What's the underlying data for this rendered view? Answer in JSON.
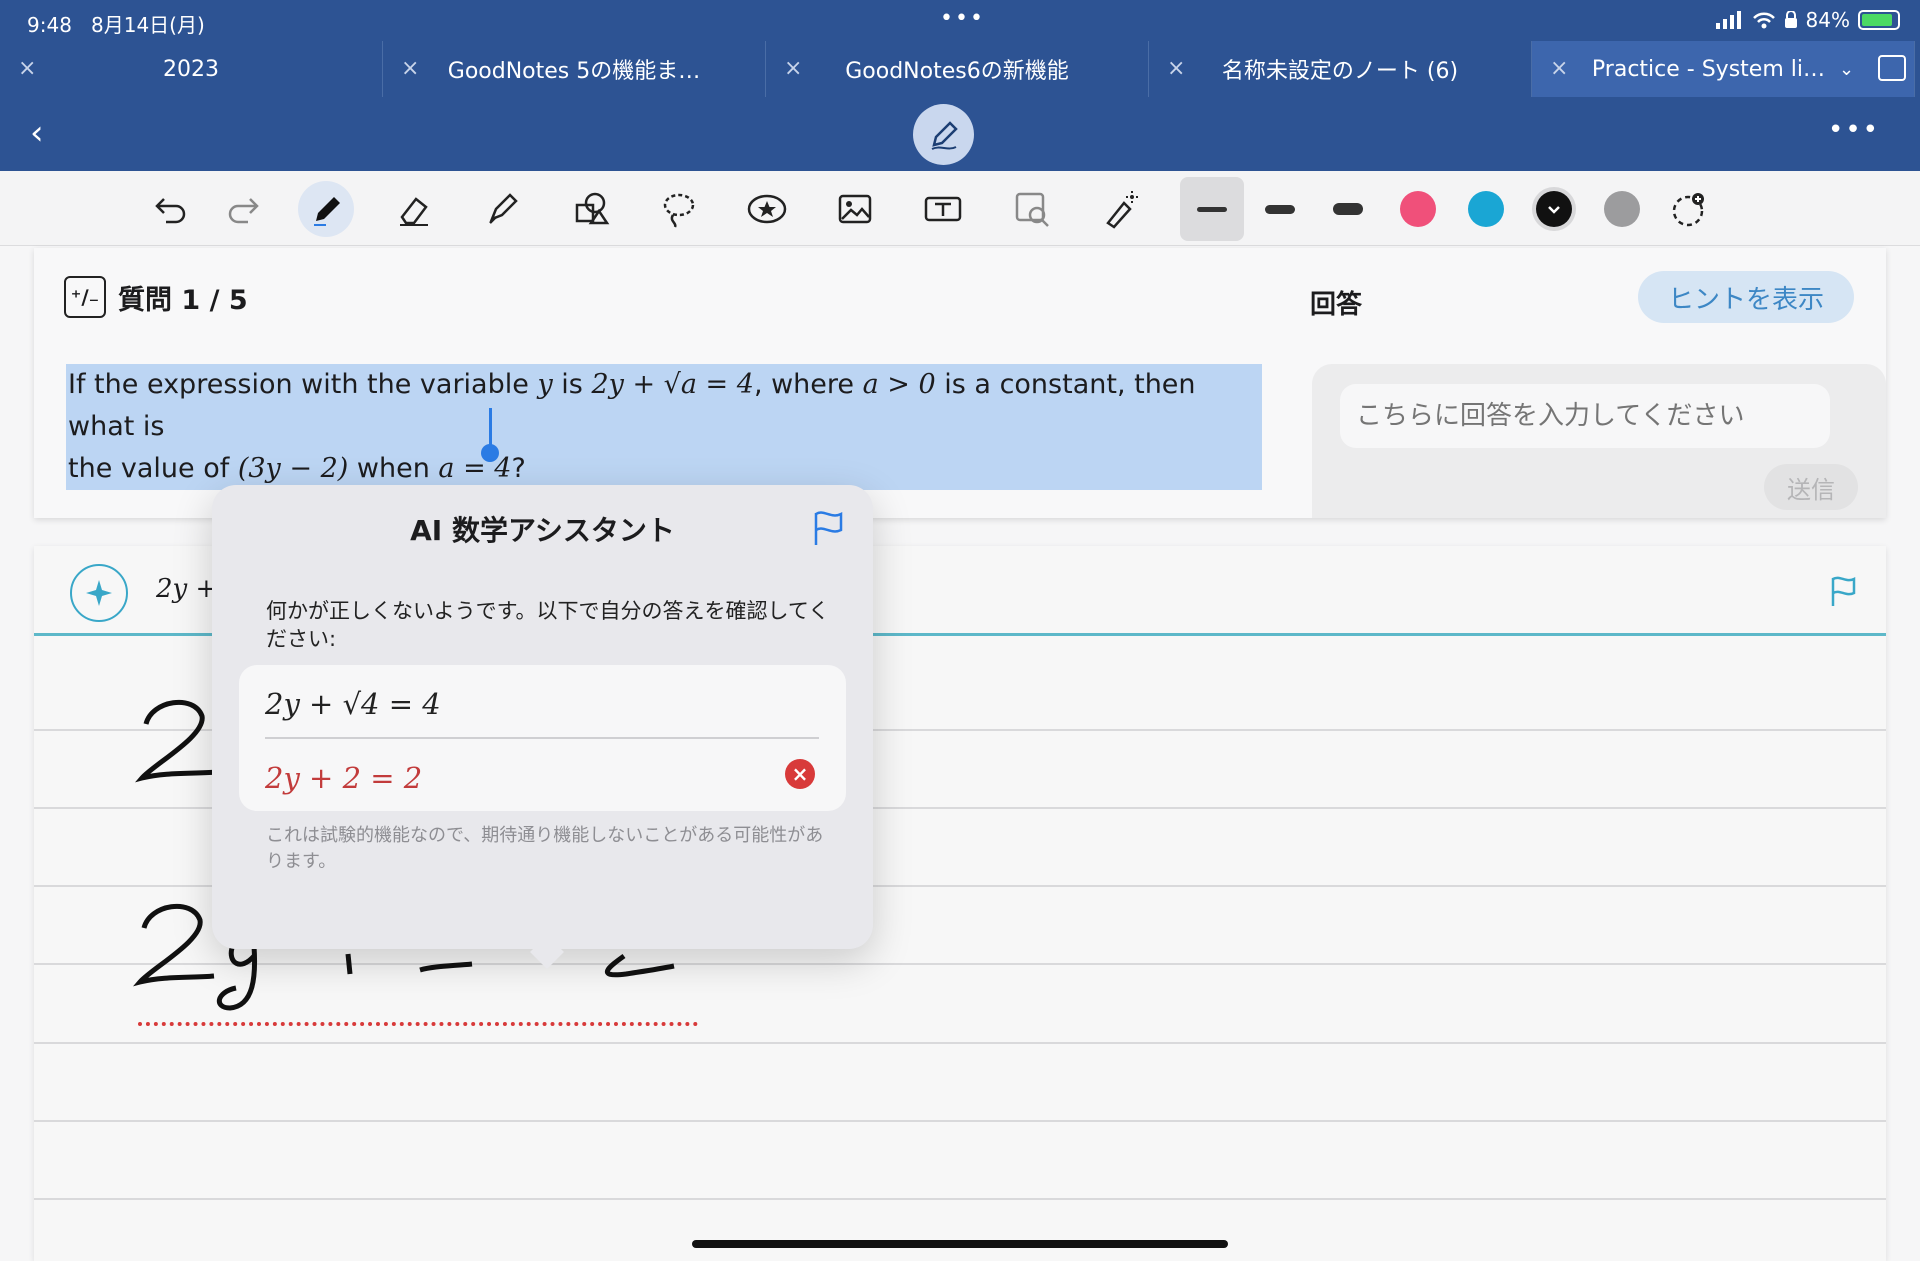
{
  "status": {
    "time": "9:48",
    "date": "8月14日(月)",
    "battery": "84%",
    "battery_level": 0.84
  },
  "tabs": [
    {
      "title": "2023",
      "active": false
    },
    {
      "title": "GoodNotes 5の機能ま…",
      "active": false
    },
    {
      "title": "GoodNotes6の新機能",
      "active": false
    },
    {
      "title": "名称未設定のノート (6)",
      "active": false
    },
    {
      "title": "Practice - System li…",
      "active": true
    }
  ],
  "toolbar": {
    "tools": [
      "undo-icon",
      "redo-icon",
      "pen-icon",
      "eraser-icon",
      "highlighter-icon",
      "shapes-icon",
      "lasso-icon",
      "sticker-icon",
      "image-icon",
      "text-box-icon",
      "camera-icon",
      "laser-pointer-icon"
    ],
    "colors": [
      "#f0507a",
      "#1aa6d4",
      "#111111",
      "#9c9c9e"
    ]
  },
  "question": {
    "counter": "質問 1 / 5",
    "text_line1_a": "If the expression with the variable ",
    "text_line1_var": "y",
    "text_line1_b": " is ",
    "text_line1_eq": "2y + √a = 4",
    "text_line1_c": ", where ",
    "text_line1_cond": "a > 0",
    "text_line1_d": " is a constant, then what is",
    "text_line2_a": "the value of ",
    "text_line2_expr": "(3y − 2)",
    "text_line2_b": " when ",
    "text_line2_cond": "a = 4",
    "text_line2_c": "?"
  },
  "answer": {
    "label": "回答",
    "hint_button": "ヒントを表示",
    "placeholder": "こちらに回答を入力してください",
    "send_button": "送信"
  },
  "note": {
    "recognized_eq": "2y +"
  },
  "assistant": {
    "title": "AI 数学アシスタント",
    "message": "何かが正しくないようです。以下で自分の答えを確認してください:",
    "steps": [
      {
        "expr": "2y + √4 = 4",
        "status": "ok"
      },
      {
        "expr": "2y + 2 = 2",
        "status": "error"
      }
    ],
    "disclaimer": "これは試験的機能なので、期待通り機能しないことがある可能性があります。"
  }
}
